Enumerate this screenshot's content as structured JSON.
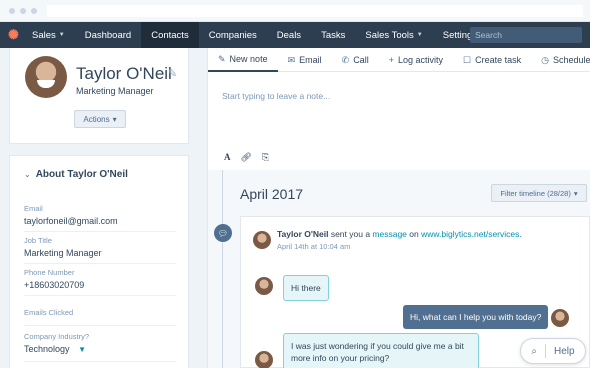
{
  "nav": {
    "brand": "Sales",
    "items": [
      "Dashboard",
      "Contacts",
      "Companies",
      "Deals",
      "Tasks",
      "Sales Tools",
      "Settings"
    ],
    "active": "Contacts",
    "search_placeholder": "Search"
  },
  "profile": {
    "name": "Taylor O'Neil",
    "role": "Marketing Manager",
    "actions_label": "Actions"
  },
  "about": {
    "heading": "About Taylor O'Neil",
    "fields": [
      {
        "label": "Email",
        "value": "taylorfoneil@gmail.com"
      },
      {
        "label": "Job Title",
        "value": "Marketing Manager"
      },
      {
        "label": "Phone Number",
        "value": "+18603020709"
      },
      {
        "label": "Emails Clicked",
        "value": ""
      },
      {
        "label": "Company Industry?",
        "value": "Technology"
      }
    ]
  },
  "composer": {
    "tabs": [
      "New note",
      "Email",
      "Call",
      "Log activity",
      "Create task",
      "Schedule"
    ],
    "active_tab": "New note",
    "placeholder": "Start typing to leave a note..."
  },
  "timeline": {
    "month": "April 2017",
    "filter_label": "Filter timeline (28/28)",
    "event": {
      "actor": "Taylor O'Neil",
      "action": " sent you a ",
      "link_text": "message",
      "mid": " on ",
      "url": "www.biglytics.net/services.",
      "time": "April 14th at 10:04 am"
    },
    "messages": [
      {
        "from": "contact",
        "text": "Hi there"
      },
      {
        "from": "me",
        "text": "Hi, what can I help you with today?"
      },
      {
        "from": "contact",
        "text": "I was just wondering if you could give me a bit more info on your pricing?"
      }
    ]
  },
  "help_label": "Help",
  "colors": {
    "nav_bg": "#2d3e50",
    "accent_orange": "#ff7a59",
    "link": "#0091ae",
    "bubble_out": "#516f90"
  }
}
